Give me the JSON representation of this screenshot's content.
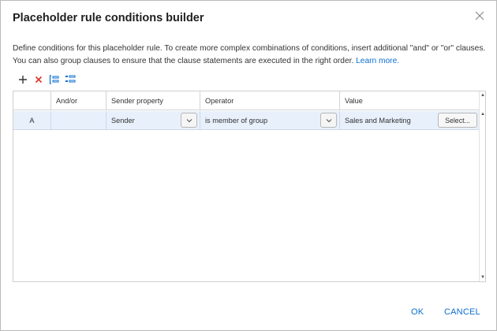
{
  "dialog": {
    "title": "Placeholder rule conditions builder",
    "close_icon": "close-icon",
    "description_text": "Define conditions for this placeholder rule. To create more complex combinations of conditions, insert additional \"and\" or \"or\" clauses. You can also group clauses to ensure that the clause statements are executed in the right order. ",
    "learn_more": "Learn more."
  },
  "toolbar": {
    "icons": [
      "add-icon",
      "delete-icon",
      "group-icon",
      "ungroup-icon"
    ],
    "colors": {
      "add": "#333333",
      "delete": "#d9342b",
      "group": "#0a6ed1"
    }
  },
  "grid": {
    "headers": [
      "",
      "And/or",
      "Sender property",
      "Operator",
      "Value"
    ],
    "rows": [
      {
        "letter": "A",
        "and_or": "",
        "sender_property": "Sender",
        "operator": "is member of group",
        "value": "Sales and Marketing",
        "select_label": "Select..."
      }
    ]
  },
  "footer": {
    "ok_label": "OK",
    "cancel_label": "CANCEL"
  }
}
